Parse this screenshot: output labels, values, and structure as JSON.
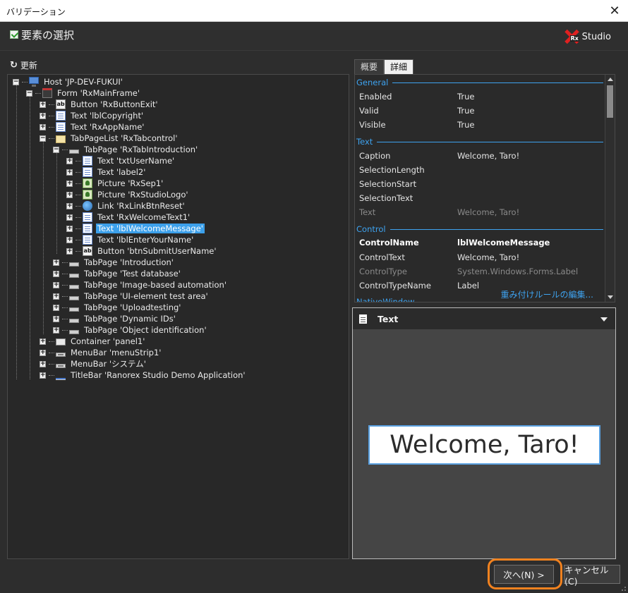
{
  "window": {
    "title": "バリデーション",
    "close_glyph": "✕"
  },
  "header": {
    "title": "要素の選択",
    "logo_rx": "Rx",
    "logo_text": "Studio"
  },
  "refresh": {
    "icon": "↻",
    "label": "更新"
  },
  "tree": {
    "nodes": [
      {
        "label": "Host 'JP-DEV-FUKUI'",
        "icon": "host-icon"
      },
      {
        "label": "Form 'RxMainFrame'",
        "icon": "form-icon"
      },
      {
        "label": "Button 'RxButtonExit'",
        "icon": "button-icon"
      },
      {
        "label": "Text 'lblCopyright'",
        "icon": "text-icon"
      },
      {
        "label": "Text 'RxAppName'",
        "icon": "text-icon"
      },
      {
        "label": "TabPageList 'RxTabcontrol'",
        "icon": "folder-icon"
      },
      {
        "label": "TabPage 'RxTabIntroduction'",
        "icon": "tabpage-icon"
      },
      {
        "label": "Text 'txtUserName'",
        "icon": "text-icon"
      },
      {
        "label": "Text 'label2'",
        "icon": "text-icon"
      },
      {
        "label": "Picture 'RxSep1'",
        "icon": "picture-icon"
      },
      {
        "label": "Picture 'RxStudioLogo'",
        "icon": "picture-icon"
      },
      {
        "label": "Link 'RxLinkBtnReset'",
        "icon": "link-icon"
      },
      {
        "label": "Text 'RxWelcomeText1'",
        "icon": "text-icon"
      },
      {
        "label": "Text 'lblWelcomeMessage'",
        "icon": "text-icon",
        "selected": true
      },
      {
        "label": "Text 'lblEnterYourName'",
        "icon": "text-icon"
      },
      {
        "label": "Button 'btnSubmitUserName'",
        "icon": "button-icon"
      },
      {
        "label": "TabPage 'Introduction'",
        "icon": "tabpage-icon"
      },
      {
        "label": "TabPage 'Test database'",
        "icon": "tabpage-icon"
      },
      {
        "label": "TabPage 'Image-based automation'",
        "icon": "tabpage-icon"
      },
      {
        "label": "TabPage 'UI-element test area'",
        "icon": "tabpage-icon"
      },
      {
        "label": "TabPage 'Uploadtesting'",
        "icon": "tabpage-icon"
      },
      {
        "label": "TabPage 'Dynamic IDs'",
        "icon": "tabpage-icon"
      },
      {
        "label": "TabPage 'Object identification'",
        "icon": "tabpage-icon"
      },
      {
        "label": "Container 'panel1'",
        "icon": "container-icon"
      },
      {
        "label": "MenuBar 'menuStrip1'",
        "icon": "menubar-icon"
      },
      {
        "label": "MenuBar 'システム'",
        "icon": "menubar-icon"
      },
      {
        "label": "TitleBar 'Ranorex Studio Demo Application'",
        "icon": "titlebar-icon"
      }
    ],
    "button_glyph": "ab"
  },
  "tabs": {
    "overview": "概要",
    "details": "詳細"
  },
  "properties": {
    "sections": {
      "general": "General",
      "text": "Text",
      "control": "Control",
      "native": "NativeWindow"
    },
    "rows": {
      "enabled": {
        "k": "Enabled",
        "v": "True"
      },
      "valid": {
        "k": "Valid",
        "v": "True"
      },
      "visible": {
        "k": "Visible",
        "v": "True"
      },
      "caption": {
        "k": "Caption",
        "v": "Welcome, Taro!"
      },
      "selection_length": {
        "k": "SelectionLength",
        "v": ""
      },
      "selection_start": {
        "k": "SelectionStart",
        "v": ""
      },
      "selection_text": {
        "k": "SelectionText",
        "v": ""
      },
      "text": {
        "k": "Text",
        "v": "Welcome, Taro!"
      },
      "control_name": {
        "k": "ControlName",
        "v": "lblWelcomeMessage"
      },
      "control_text": {
        "k": "ControlText",
        "v": "Welcome, Taro!"
      },
      "control_type": {
        "k": "ControlType",
        "v": "System.Windows.Forms.Label"
      },
      "control_type_name": {
        "k": "ControlTypeName",
        "v": "Label"
      }
    },
    "edit_weight_rules_link": "重み付けルールの編集..."
  },
  "preview": {
    "element_type": "Text",
    "captured_text": "Welcome, Taro!"
  },
  "footer": {
    "next_label": "次へ(N) >",
    "cancel_label": "キャンセル(C)"
  },
  "colors": {
    "accent": "#3ea3f0",
    "selection": "#3ca0ea",
    "highlight_ring": "#f2821f",
    "logo_red": "#e02020"
  }
}
